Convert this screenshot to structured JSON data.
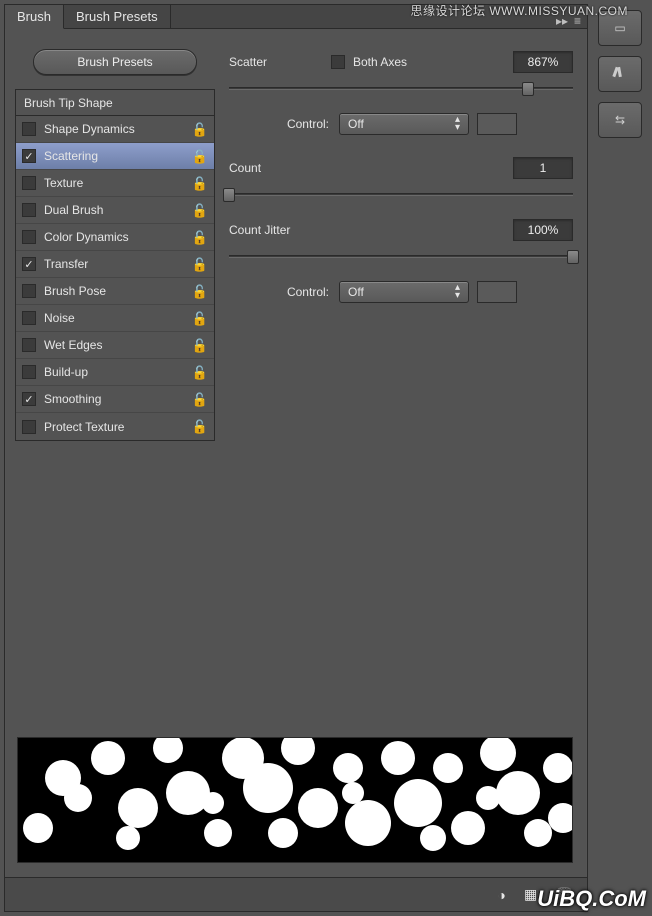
{
  "watermarks": {
    "top": "思缘设计论坛  WWW.MISSYUAN.COM",
    "bottom": "UiBQ.CoM"
  },
  "tabs": {
    "brush": "Brush",
    "presets": "Brush Presets"
  },
  "sidebar": {
    "presets_btn": "Brush Presets",
    "tip_header": "Brush Tip Shape",
    "items": [
      {
        "label": "Shape Dynamics",
        "checked": false,
        "lock": true,
        "selected": false
      },
      {
        "label": "Scattering",
        "checked": true,
        "lock": true,
        "selected": true
      },
      {
        "label": "Texture",
        "checked": false,
        "lock": true,
        "selected": false
      },
      {
        "label": "Dual Brush",
        "checked": false,
        "lock": true,
        "selected": false
      },
      {
        "label": "Color Dynamics",
        "checked": false,
        "lock": true,
        "selected": false
      },
      {
        "label": "Transfer",
        "checked": true,
        "lock": true,
        "selected": false
      },
      {
        "label": "Brush Pose",
        "checked": false,
        "lock": true,
        "selected": false
      },
      {
        "label": "Noise",
        "checked": false,
        "lock": true,
        "selected": false
      },
      {
        "label": "Wet Edges",
        "checked": false,
        "lock": true,
        "selected": false
      },
      {
        "label": "Build-up",
        "checked": false,
        "lock": true,
        "selected": false
      },
      {
        "label": "Smoothing",
        "checked": true,
        "lock": true,
        "selected": false
      },
      {
        "label": "Protect Texture",
        "checked": false,
        "lock": true,
        "selected": false
      }
    ]
  },
  "settings": {
    "scatter": {
      "label": "Scatter",
      "both_axes_label": "Both Axes",
      "both_axes_checked": false,
      "value": "867%",
      "slider_pct": 87
    },
    "control1": {
      "label": "Control:",
      "value": "Off"
    },
    "count": {
      "label": "Count",
      "value": "1",
      "slider_pct": 0
    },
    "jitter": {
      "label": "Count Jitter",
      "value": "100%",
      "slider_pct": 100
    },
    "control2": {
      "label": "Control:",
      "value": "Off"
    }
  },
  "icons": {
    "dd_caret": "▲\n▼",
    "lock": "🔒",
    "flyout": "▸▸",
    "menu": "≡"
  }
}
